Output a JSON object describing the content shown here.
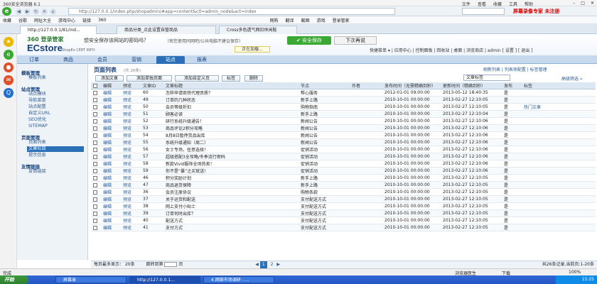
{
  "browser": {
    "title": "360安全浏览器 6.1",
    "menu": [
      "文件",
      "查看",
      "收藏",
      "工具",
      "帮助"
    ],
    "url": "http://127.0.0.1/index.php/shopadmin/#app=content&ctl=admin_node&act=index",
    "recorder": "屏幕录像专家 未注册",
    "favorites": [
      "收藏",
      "谷歌",
      "网址大全",
      "游戏中心",
      "链接",
      "360",
      "网购",
      "翻译",
      "截图",
      "游戏",
      "登录管家"
    ],
    "tabs": [
      "http://127.0.0.1/81/ind...",
      "商品分类_点此设置自管商品",
      "Cross多色透气网扣休闲鞋"
    ]
  },
  "savepw": {
    "brand": "360 登录管家",
    "question": "想安全保存该网站的密码吗？",
    "hint": "（密您使用同网吧/公共电脑不建议保存）",
    "save": "安全保存",
    "later": "下次再说"
  },
  "app": {
    "brand": "ECstore",
    "brand_sub": "ShopEx CERT INFO",
    "loading": "正在加载...",
    "toplinks": "快捷菜单 ▾ | 应用中心 | 控制面板 | 回收站 | 桌面 | 浏览商店 | admin [ 设置 ] [ 退出 ]",
    "nav": [
      "订单",
      "商品",
      "会员",
      "营销",
      "站点",
      "报表"
    ],
    "nav_active": "站点"
  },
  "leftnav": {
    "groups": [
      {
        "title": "模板管理",
        "items": [
          "模板列表"
        ]
      },
      {
        "title": "站点管理",
        "items": [
          "站点模块",
          "导航菜单",
          "站点配置",
          "自定义URL",
          "SEO优化",
          "SITEMAP"
        ]
      },
      {
        "title": "页面管理",
        "items": [
          "页面列表",
          "文章栏目",
          "提示信息"
        ]
      },
      {
        "title": "友情链接",
        "items": [
          "友情链接"
        ]
      }
    ],
    "active": "文章栏目"
  },
  "page": {
    "title": "页面列表",
    "subtitle": "(共 26条)",
    "right_links": "刷新列表 | 列表项配置 | 标签管理",
    "buttons": [
      "添加文章",
      "添加单独页面",
      "添加自定义页",
      "标签",
      "删除"
    ],
    "label_select": "文章标签",
    "adv_search": "高级筛选 »",
    "columns": [
      "编辑",
      "预览",
      "文章ID",
      "文章标题",
      "节点",
      "作者",
      "发布时间（无需精确到秒）",
      "更新时间（精确到秒）",
      "发布",
      "标签"
    ],
    "rows": [
      [
        "编辑",
        "预览",
        "60",
        "怎样申请商铁代理资质？",
        "帮心服务",
        "",
        "2012-01-01 09:00:00",
        "2013-05-12 18:40:35",
        "是",
        ""
      ],
      [
        "编辑",
        "预览",
        "49",
        "订单的几种状态",
        "新手上路",
        "",
        "2010-10-01 00:00:00",
        "2013-02-27 12:10:05",
        "是",
        ""
      ],
      [
        "编辑",
        "预览",
        "50",
        "会员等级折扣",
        "购物指南",
        "",
        "2010-10-01 00:00:00",
        "2013-02-27 12:10:05",
        "是",
        "热门文章"
      ],
      [
        "编辑",
        "预览",
        "51",
        "顾客必读",
        "新手上路",
        "",
        "2010-10-01 00:00:00",
        "2013-02-27 12:10:04",
        "是",
        ""
      ],
      [
        "编辑",
        "预览",
        "52",
        "研行系统升级通告！",
        "新闻公告",
        "",
        "2010-10-01 00:00:00",
        "2013-02-27 12:10:06",
        "是",
        ""
      ],
      [
        "编辑",
        "预览",
        "53",
        "商品评论2积分攻略",
        "新闻公告",
        "",
        "2010-10-01 00:00:00",
        "2013-02-27 12:10:06",
        "是",
        ""
      ],
      [
        "编辑",
        "预览",
        "54",
        "8月8日暂停货品出库",
        "新闻公告",
        "",
        "2010-10-01 00:00:00",
        "2013-02-27 12:10:06",
        "是",
        ""
      ],
      [
        "编辑",
        "预览",
        "55",
        "系统升级通知（周二）",
        "新闻公告",
        "",
        "2010-10-01 00:00:00",
        "2013-02-27 12:10:06",
        "是",
        ""
      ],
      [
        "编辑",
        "预览",
        "56",
        "女士专场，任意选择！",
        "促销活动",
        "",
        "2010-10-01 00:00:00",
        "2013-02-27 12:10:06",
        "是",
        ""
      ],
      [
        "编辑",
        "预览",
        "57",
        "超级搭配3全攻略/冬季流行密码",
        "促销活动",
        "",
        "2010-10-01 00:00:00",
        "2013-02-27 12:10:06",
        "是",
        ""
      ],
      [
        "编辑",
        "预览",
        "58",
        "新款Vivid服饰全场热卖！",
        "促销活动",
        "",
        "2010-10-01 00:00:00",
        "2013-02-27 12:10:06",
        "是",
        ""
      ],
      [
        "编辑",
        "预览",
        "59",
        "你不是“暴”之买就送！",
        "促销活动",
        "",
        "2010-10-01 00:00:00",
        "2013-02-27 12:10:06",
        "是",
        ""
      ],
      [
        "编辑",
        "预览",
        "46",
        "积分奖励计划",
        "新手上路",
        "",
        "2010-10-01 00:00:00",
        "2013-02-27 12:10:05",
        "是",
        ""
      ],
      [
        "编辑",
        "预览",
        "47",
        "商品退货保障",
        "新手上路",
        "",
        "2010-10-01 00:00:00",
        "2013-02-27 12:10:05",
        "是",
        ""
      ],
      [
        "编辑",
        "预览",
        "36",
        "会员注册协议",
        "购物条款",
        "",
        "2010-10-01 00:00:00",
        "2013-02-27 12:10:05",
        "是",
        ""
      ],
      [
        "编辑",
        "预览",
        "37",
        "关于运货和配送",
        "支付配送方式",
        "",
        "2010-10-01 00:00:00",
        "2013-02-27 12:10:05",
        "是",
        ""
      ],
      [
        "编辑",
        "预览",
        "38",
        "网上支付小贴士",
        "支付配送方式",
        "",
        "2010-10-01 00:00:00",
        "2013-02-27 12:10:05",
        "是",
        ""
      ],
      [
        "编辑",
        "预览",
        "39",
        "订单何时出库？",
        "支付配送方式",
        "",
        "2010-10-01 00:00:00",
        "2013-02-27 12:10:05",
        "是",
        ""
      ],
      [
        "编辑",
        "预览",
        "40",
        "配送方式",
        "支付配送方式",
        "",
        "2010-10-01 00:00:00",
        "2013-02-27 12:10:05",
        "是",
        ""
      ],
      [
        "编辑",
        "预览",
        "41",
        "支付方式",
        "支付配送方式",
        "",
        "2010-10-01 00:00:00",
        "2013-02-27 12:10:05",
        "是",
        ""
      ]
    ]
  },
  "pager": {
    "per_page_label": "每页最多显示：",
    "per_page": "20条",
    "jump_label": "跳转到第",
    "page_unit": "页",
    "pages": [
      "1",
      "2"
    ],
    "summary": "共26条记录,当前页:1-20条"
  },
  "status": {
    "left": "完成",
    "items": [
      "浏览器医生",
      "下载",
      "100%"
    ]
  },
  "taskbar": {
    "start": "开始",
    "tasks": [
      "屏幕录",
      "http://127.0.0.1...",
      "4.网络市场调研 - ..."
    ],
    "time": "15:25"
  }
}
